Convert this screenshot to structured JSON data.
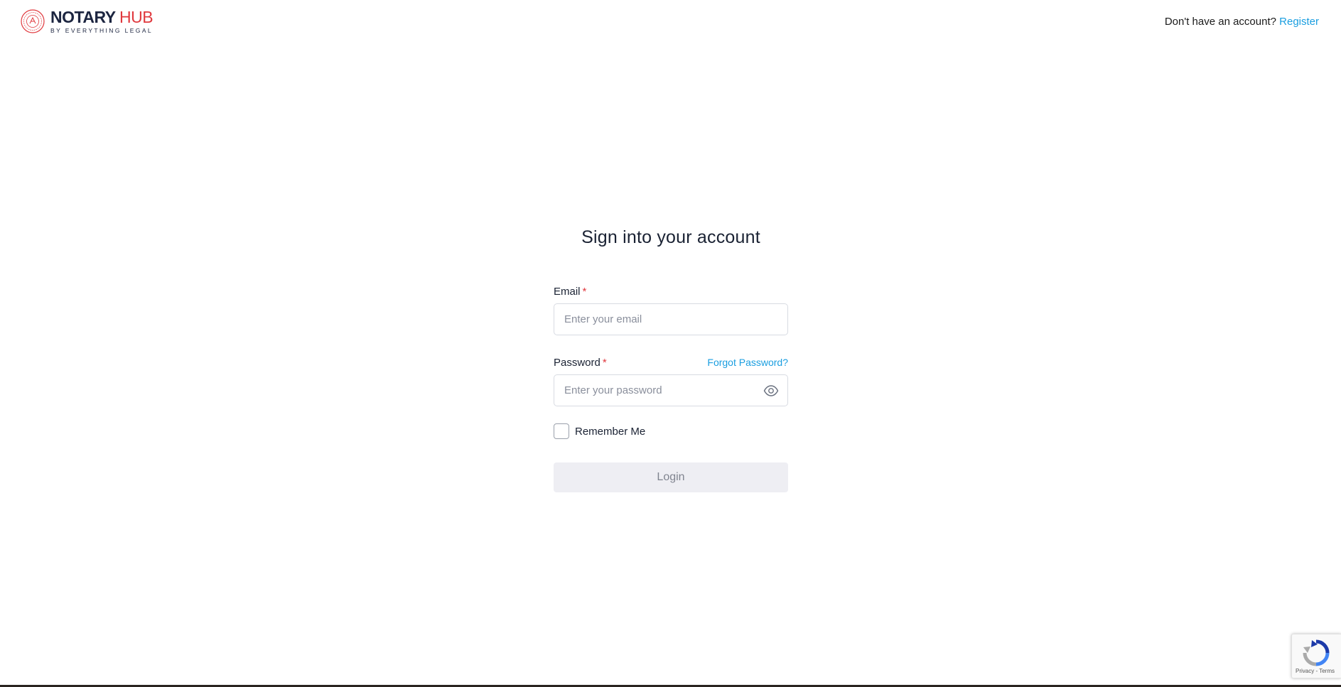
{
  "header": {
    "logo": {
      "main_word1": "NOTARY",
      "main_word2": "HUB",
      "sub": "BY EVERYTHING LEGAL"
    },
    "account_prompt": "Don't have an account?",
    "register_label": "Register"
  },
  "form": {
    "title": "Sign into your account",
    "email": {
      "label": "Email",
      "required_mark": "*",
      "placeholder": "Enter your email",
      "value": ""
    },
    "password": {
      "label": "Password",
      "required_mark": "*",
      "placeholder": "Enter your password",
      "value": "",
      "forgot_label": "Forgot Password?",
      "toggle_icon": "eye-icon"
    },
    "remember": {
      "label": "Remember Me",
      "checked": false
    },
    "submit_label": "Login"
  },
  "recaptcha": {
    "privacy": "Privacy",
    "separator": " - ",
    "terms": "Terms"
  },
  "colors": {
    "brand_dark": "#1c2540",
    "brand_red": "#e0393e",
    "link_blue": "#1a9ee0",
    "button_disabled_bg": "#eeeef3"
  }
}
